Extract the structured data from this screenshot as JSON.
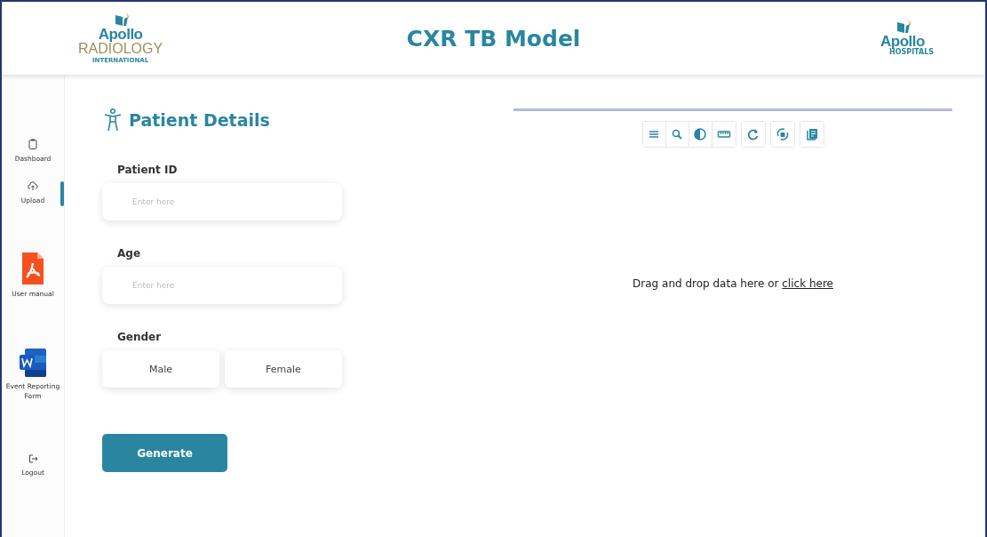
{
  "header": {
    "left_logo": {
      "brand": "Apollo",
      "name": "RADIOLOGY",
      "tagline": "INTERNATIONAL"
    },
    "title": "CXR TB Model",
    "right_logo": {
      "brand": "Apollo",
      "name": "HOSPITALS"
    }
  },
  "sidebar": {
    "items": [
      {
        "kind": "dashboard",
        "label": "Dashboard",
        "selected": false
      },
      {
        "kind": "upload",
        "label": "Upload",
        "selected": true
      },
      {
        "kind": "pdf",
        "label": "User manual",
        "selected": false
      },
      {
        "kind": "word",
        "label": "Event Reporting Form",
        "selected": false
      },
      {
        "kind": "logout",
        "label": "Logout",
        "selected": false
      }
    ]
  },
  "patient_details": {
    "heading": "Patient Details",
    "fields": [
      {
        "label": "Patient ID",
        "placeholder": "Enter here"
      },
      {
        "label": "Age",
        "placeholder": "Enter here"
      }
    ],
    "gender": {
      "label": "Gender",
      "options": [
        {
          "label": "Male",
          "selected": false
        },
        {
          "label": "Female",
          "selected": false
        }
      ]
    },
    "submit": "Generate"
  },
  "viewer": {
    "dropzone": {
      "text": "Drag and drop data here or ",
      "link": "click here"
    }
  }
}
